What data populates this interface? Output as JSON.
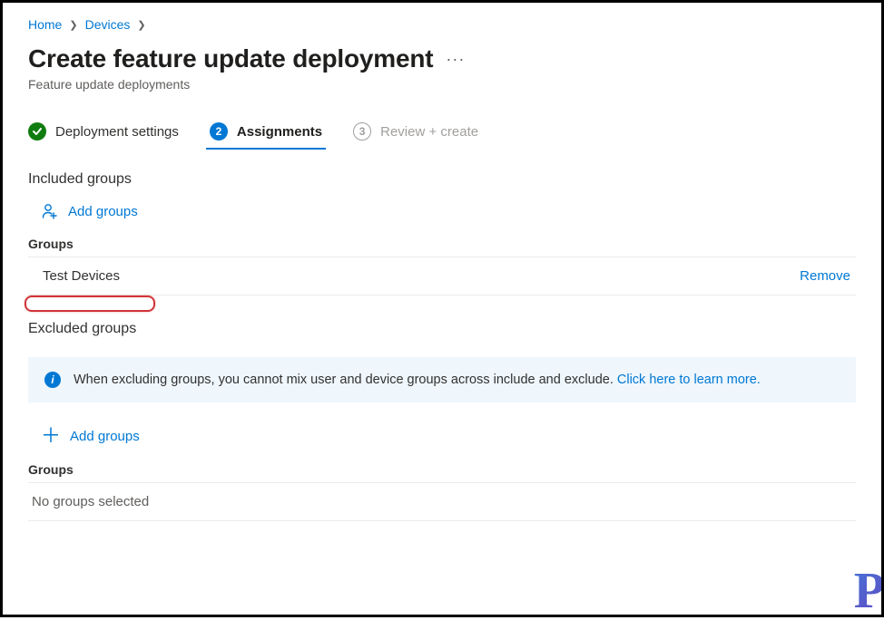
{
  "breadcrumb": {
    "items": [
      "Home",
      "Devices"
    ]
  },
  "header": {
    "title": "Create feature update deployment",
    "subtitle": "Feature update deployments"
  },
  "steps": [
    {
      "num": "✓",
      "label": "Deployment settings",
      "state": "completed"
    },
    {
      "num": "2",
      "label": "Assignments",
      "state": "active"
    },
    {
      "num": "3",
      "label": "Review + create",
      "state": "disabled"
    }
  ],
  "included": {
    "heading": "Included groups",
    "add_label": "Add groups",
    "table_label": "Groups",
    "rows": [
      {
        "name": "Test Devices",
        "action": "Remove"
      }
    ]
  },
  "excluded": {
    "heading": "Excluded groups",
    "info_text": "When excluding groups, you cannot mix user and device groups across include and exclude. ",
    "info_link": "Click here to learn more.",
    "add_label": "Add groups",
    "table_label": "Groups",
    "empty_text": "No groups selected"
  },
  "watermark": "P"
}
